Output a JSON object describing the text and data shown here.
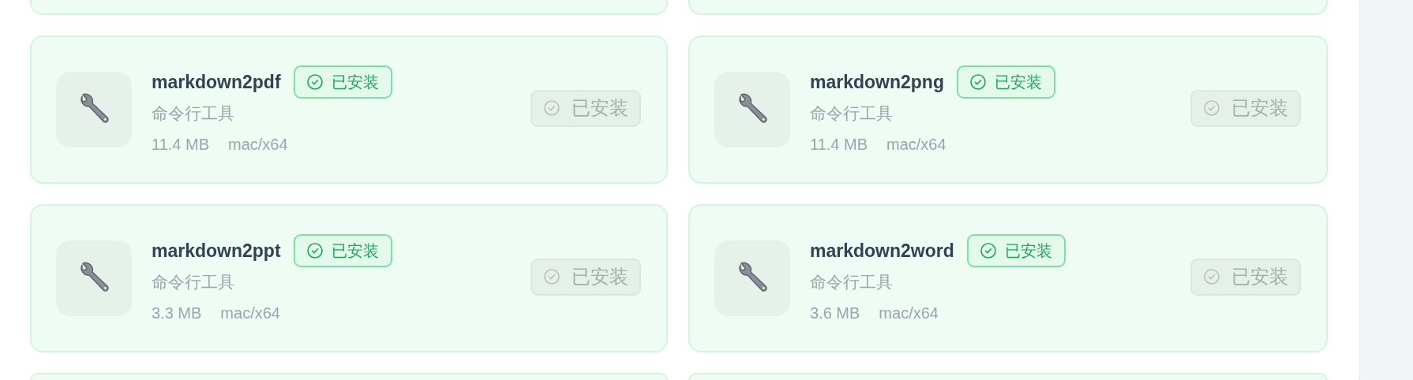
{
  "tools": [
    {
      "kind": "stub"
    },
    {
      "kind": "stub"
    },
    {
      "kind": "tool",
      "name": "markdown2pdf",
      "badge": "已安装",
      "description": "命令行工具",
      "size": "11.4 MB",
      "platform": "mac/x64",
      "button": {
        "label": "已安装",
        "disabled": true
      }
    },
    {
      "kind": "tool",
      "name": "markdown2png",
      "badge": "已安装",
      "description": "命令行工具",
      "size": "11.4 MB",
      "platform": "mac/x64",
      "button": {
        "label": "已安装",
        "disabled": true
      }
    },
    {
      "kind": "tool",
      "name": "markdown2ppt",
      "badge": "已安装",
      "description": "命令行工具",
      "size": "3.3 MB",
      "platform": "mac/x64",
      "button": {
        "label": "已安装",
        "disabled": true
      }
    },
    {
      "kind": "tool",
      "name": "markdown2word",
      "badge": "已安装",
      "description": "命令行工具",
      "size": "3.6 MB",
      "platform": "mac/x64",
      "button": {
        "label": "已安装",
        "disabled": true
      }
    },
    {
      "kind": "stub"
    },
    {
      "kind": "stub"
    }
  ]
}
